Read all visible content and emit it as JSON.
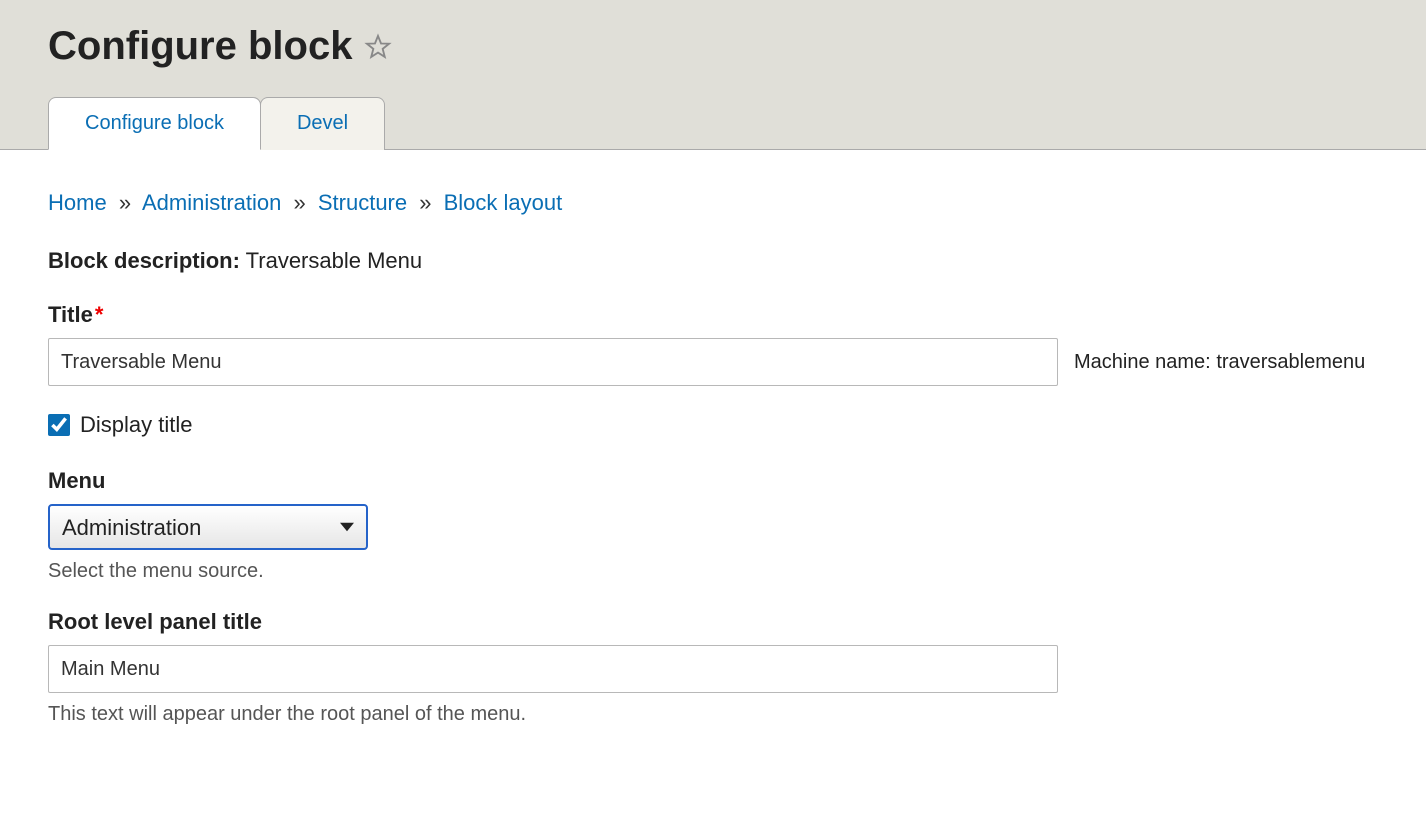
{
  "header": {
    "title": "Configure block"
  },
  "tabs": [
    {
      "label": "Configure block"
    },
    {
      "label": "Devel"
    }
  ],
  "breadcrumb": {
    "items": [
      "Home",
      "Administration",
      "Structure",
      "Block layout"
    ]
  },
  "block_description": {
    "label": "Block description:",
    "value": "Traversable Menu"
  },
  "form": {
    "title": {
      "label": "Title",
      "value": "Traversable Menu"
    },
    "machine_name": {
      "label": "Machine name:",
      "value": "traversablemenu"
    },
    "display_title": {
      "label": "Display title",
      "checked": true
    },
    "menu": {
      "label": "Menu",
      "selected": "Administration",
      "help": "Select the menu source."
    },
    "root_panel_title": {
      "label": "Root level panel title",
      "value": "Main Menu",
      "help": "This text will appear under the root panel of the menu."
    }
  }
}
